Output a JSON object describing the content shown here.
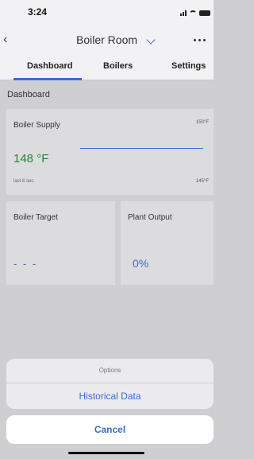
{
  "status_bar": {
    "time": "3:24",
    "icons": [
      "signal-icon",
      "wifi-icon",
      "battery-icon"
    ]
  },
  "nav": {
    "title": "Boiler Room",
    "back_icon": "chevron-left-icon",
    "dropdown_icon": "chevron-down-icon",
    "more_icon": "more-icon"
  },
  "tabs": [
    {
      "label": "Dashboard",
      "active": true
    },
    {
      "label": "Boilers",
      "active": false
    },
    {
      "label": "Settings",
      "active": false
    }
  ],
  "section": {
    "title": "Dashboard"
  },
  "cards": {
    "boiler_supply": {
      "label": "Boiler Supply",
      "value": "148 °F",
      "max": "150°F",
      "min": "145°F",
      "updated": "last 6 sec."
    },
    "boiler_target": {
      "label": "Boiler Target",
      "value": "- - -"
    },
    "plant_output": {
      "label": "Plant Output",
      "value": "0%"
    }
  },
  "action_sheet": {
    "title": "Options",
    "options": [
      "Historical Data"
    ],
    "cancel_label": "Cancel"
  },
  "colors": {
    "accent": "#3a6bd8",
    "value_green": "#1f8a3a",
    "background": "#cfcfd1"
  }
}
